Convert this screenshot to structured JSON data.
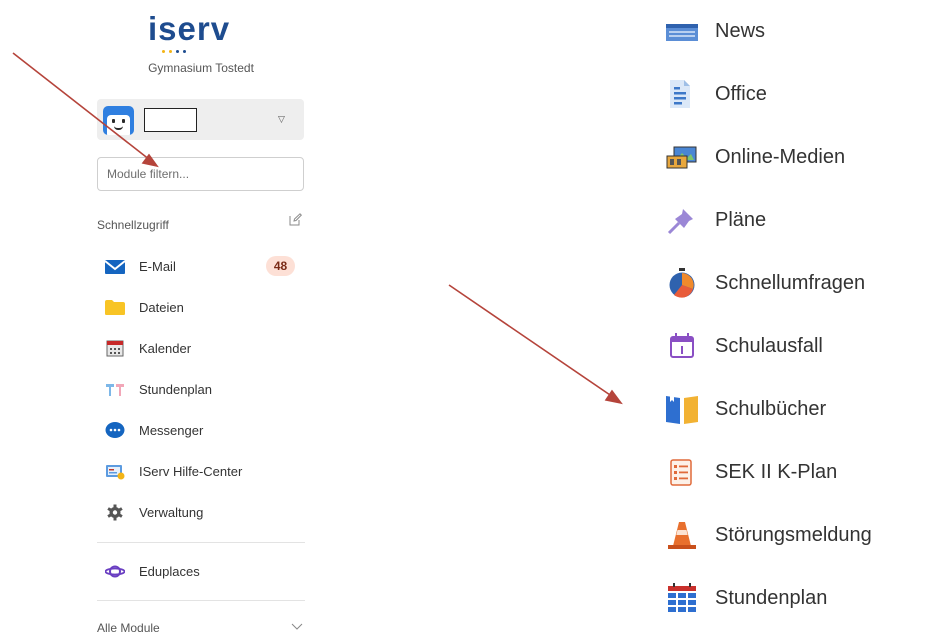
{
  "brand": {
    "logo_text": "iserv",
    "school_name": "Gymnasium Tostedt",
    "logo_color": "#1e4c8f",
    "dot_accent": "#f3b416"
  },
  "user_menu": {
    "avatar_icon": "robot-avatar-icon",
    "username": "",
    "dropdown_icon": "caret-down-icon"
  },
  "search": {
    "placeholder": "Module filtern..."
  },
  "quick_access": {
    "title": "Schnellzugriff",
    "edit_icon": "pencil-edit-icon",
    "items": [
      {
        "label": "E-Mail",
        "icon": "mail-icon",
        "badge": "48"
      },
      {
        "label": "Dateien",
        "icon": "folder-icon"
      },
      {
        "label": "Kalender",
        "icon": "calendar-icon"
      },
      {
        "label": "Stundenplan",
        "icon": "timetable-icon"
      },
      {
        "label": "Messenger",
        "icon": "chat-bubble-icon"
      },
      {
        "label": "IServ Hilfe-Center",
        "icon": "help-center-icon"
      },
      {
        "label": "Verwaltung",
        "icon": "gear-icon"
      }
    ]
  },
  "extra": {
    "items": [
      {
        "label": "Eduplaces",
        "icon": "planet-icon"
      }
    ]
  },
  "all_modules": {
    "label": "Alle Module",
    "icon": "chevron-down-icon"
  },
  "module_list": {
    "items": [
      {
        "label": "News",
        "icon": "news-icon"
      },
      {
        "label": "Office",
        "icon": "document-icon"
      },
      {
        "label": "Online-Medien",
        "icon": "media-icon"
      },
      {
        "label": "Pläne",
        "icon": "pushpin-icon"
      },
      {
        "label": "Schnellumfragen",
        "icon": "stopwatch-icon"
      },
      {
        "label": "Schulausfall",
        "icon": "calendar-cancel-icon"
      },
      {
        "label": "Schulbücher",
        "icon": "books-icon"
      },
      {
        "label": "SEK II K-Plan",
        "icon": "checklist-icon"
      },
      {
        "label": "Störungsmeldung",
        "icon": "traffic-cone-icon"
      },
      {
        "label": "Stundenplan",
        "icon": "timetable-icon"
      }
    ]
  },
  "annotations": {
    "arrow_color": "#b5443b"
  }
}
